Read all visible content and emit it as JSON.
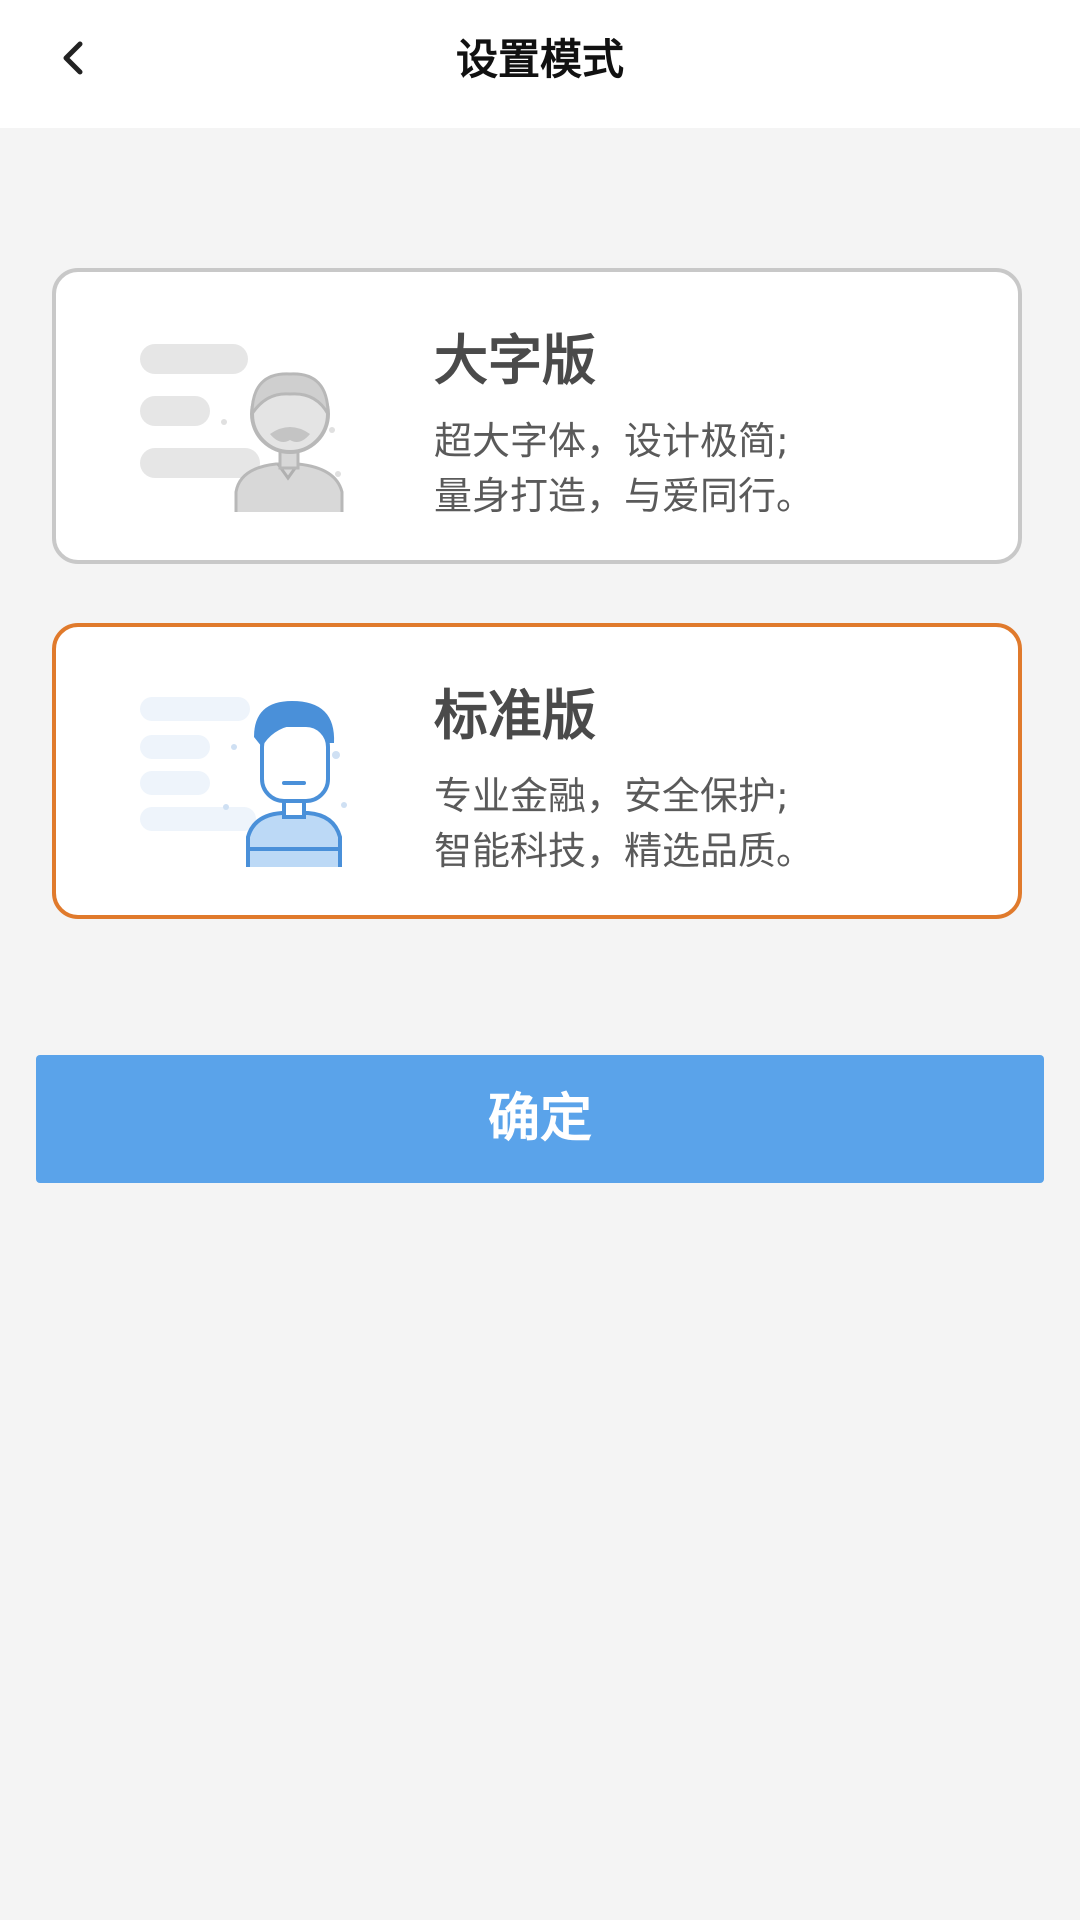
{
  "header": {
    "title": "设置模式",
    "back_icon": "chevron-left-icon"
  },
  "modes": [
    {
      "title": "大字版",
      "desc_line1": "超大字体，设计极简;",
      "desc_line2": "量身打造，与爱同行。",
      "selected": false,
      "illustration": "elderly-person-icon"
    },
    {
      "title": "标准版",
      "desc_line1": "专业金融，安全保护;",
      "desc_line2": "智能科技，精选品质。",
      "selected": true,
      "illustration": "young-person-icon"
    }
  ],
  "confirm_label": "确定",
  "colors": {
    "selected_border": "#e07a2c",
    "unselected_border": "#c8c8c8",
    "primary_button": "#5aa3ea",
    "background": "#f4f4f4"
  }
}
